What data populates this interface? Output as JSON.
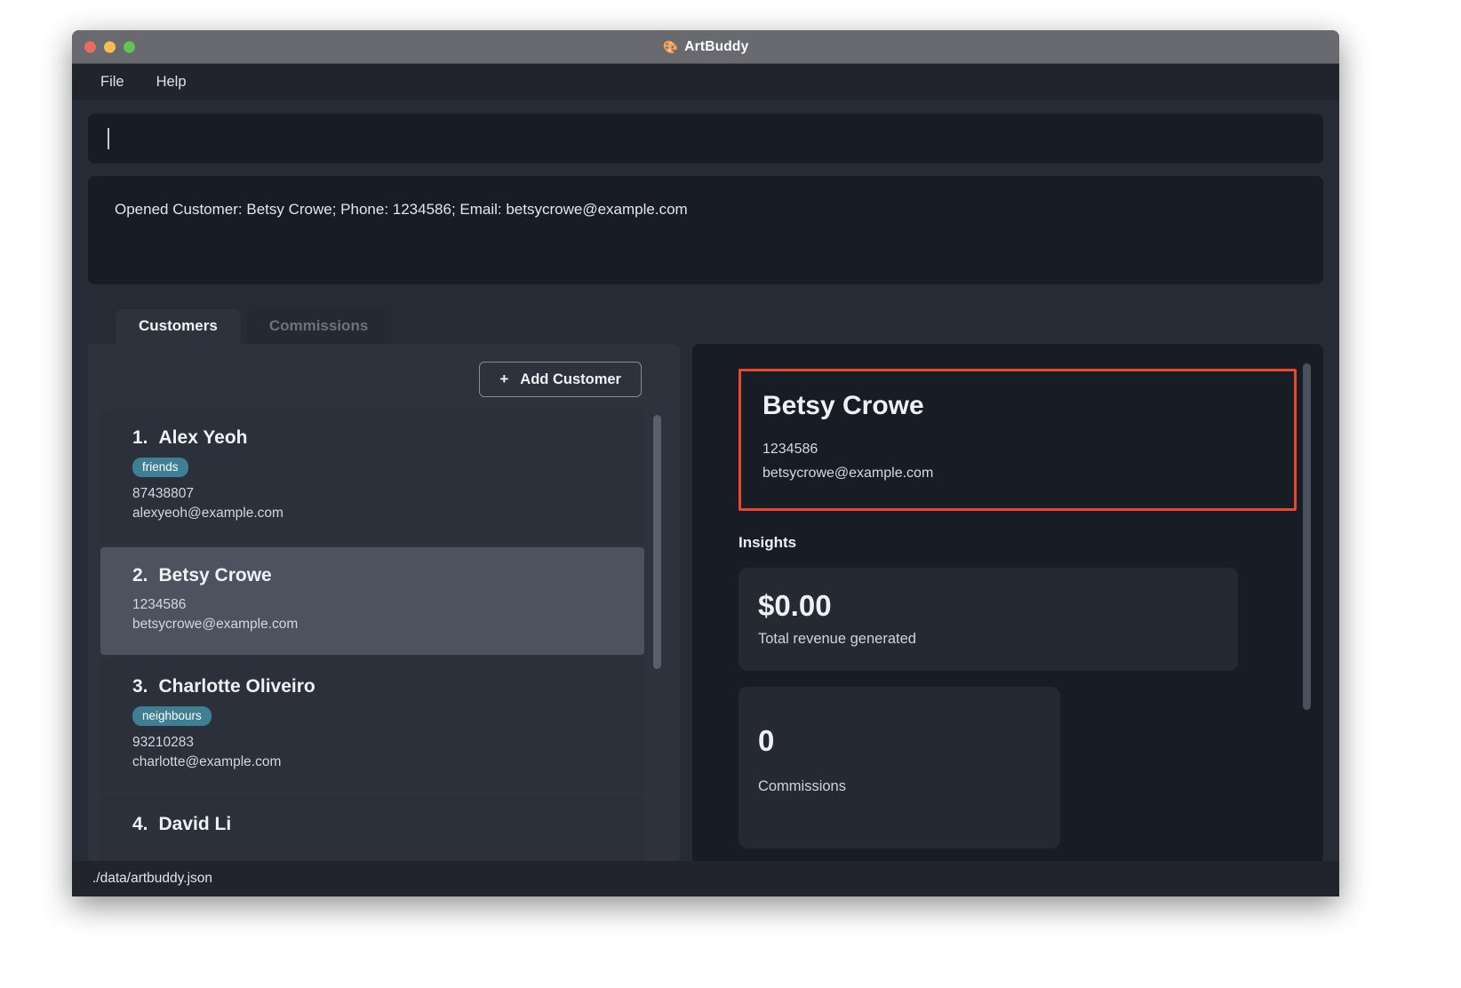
{
  "window": {
    "title": "ArtBuddy",
    "title_icon": "🎨",
    "traffic_lights": [
      "close",
      "minimize",
      "maximize"
    ]
  },
  "menubar": {
    "items": [
      {
        "label": "File"
      },
      {
        "label": "Help"
      }
    ]
  },
  "command_input": {
    "value": "",
    "placeholder": ""
  },
  "result_box": {
    "text": "Opened Customer: Betsy Crowe; Phone: 1234586; Email: betsycrowe@example.com"
  },
  "tabs": [
    {
      "label": "Customers",
      "active": true
    },
    {
      "label": "Commissions",
      "active": false
    }
  ],
  "toolbar": {
    "add_customer_label": "Add Customer",
    "plus_icon": "+"
  },
  "customer_list": [
    {
      "index": "1.",
      "name": "Alex Yeoh",
      "tag": "friends",
      "phone": "87438807",
      "email": "alexyeoh@example.com",
      "selected": false
    },
    {
      "index": "2.",
      "name": "Betsy Crowe",
      "tag": "",
      "phone": "1234586",
      "email": "betsycrowe@example.com",
      "selected": true
    },
    {
      "index": "3.",
      "name": "Charlotte Oliveiro",
      "tag": "neighbours",
      "phone": "93210283",
      "email": "charlotte@example.com",
      "selected": false
    },
    {
      "index": "4.",
      "name": "David Li",
      "tag": "",
      "phone": "",
      "email": "",
      "selected": false
    }
  ],
  "detail": {
    "name": "Betsy Crowe",
    "phone": "1234586",
    "email": "betsycrowe@example.com",
    "insights_heading": "Insights",
    "stats": [
      {
        "value": "$0.00",
        "label": "Total revenue generated"
      },
      {
        "value": "0",
        "label": "Commissions"
      }
    ]
  },
  "statusbar": {
    "path": "./data/artbuddy.json"
  },
  "colors": {
    "accent_highlight": "#e8472b",
    "tag_background": "#3e7f94",
    "window_chrome": "#686a70",
    "app_background": "#272b35",
    "panel_dark": "#181c24",
    "selected_row": "#4c535f"
  }
}
